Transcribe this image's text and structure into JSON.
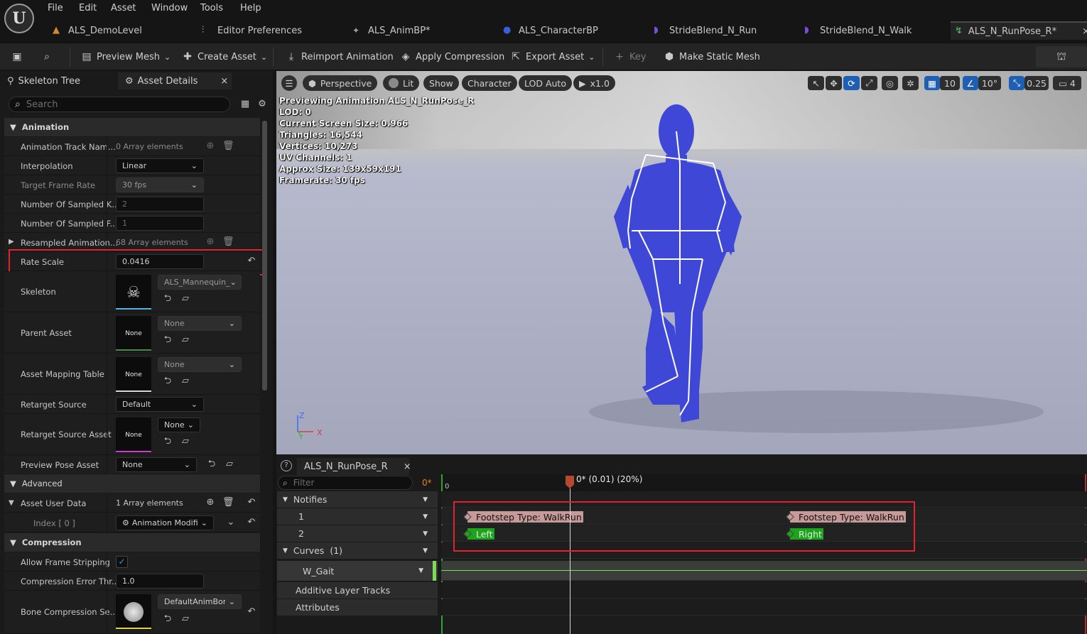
{
  "menu": [
    "File",
    "Edit",
    "Asset",
    "Window",
    "Tools",
    "Help"
  ],
  "doc_tabs": [
    "ALS_DemoLevel",
    "Editor Preferences",
    "ALS_AnimBP*",
    "ALS_CharacterBP",
    "StrideBlend_N_Run",
    "StrideBlend_N_Walk",
    "ALS_N_RunPose_R*"
  ],
  "toolbar": {
    "preview_mesh": "Preview Mesh",
    "create_asset": "Create Asset",
    "reimport": "Reimport Animation",
    "apply_compression": "Apply Compression",
    "export_asset": "Export Asset",
    "key": "Key",
    "make_static_mesh": "Make Static Mesh"
  },
  "left_tabs": {
    "skeleton_tree": "Skeleton Tree",
    "asset_details": "Asset Details"
  },
  "search": {
    "placeholder": "Search"
  },
  "details": {
    "animation_category": "Animation",
    "track_names_label": "Animation Track Nam...",
    "track_names_value": "0 Array elements",
    "interpolation_label": "Interpolation",
    "interpolation_value": "Linear",
    "target_frame_rate_label": "Target Frame Rate",
    "target_frame_rate_value": "30 fps",
    "sampled_keys_label": "Number Of Sampled K...",
    "sampled_keys_value": "2",
    "sampled_frames_label": "Number Of Sampled F...",
    "sampled_frames_value": "1",
    "resampled_label": "Resampled Animation...",
    "resampled_value": "68 Array elements",
    "rate_scale_label": "Rate Scale",
    "rate_scale_value": "0.0416",
    "skeleton_label": "Skeleton",
    "skeleton_value": "ALS_Mannequin_",
    "parent_asset_label": "Parent Asset",
    "parent_asset_value": "None",
    "parent_asset_thumb": "None",
    "mapping_table_label": "Asset Mapping Table",
    "mapping_table_value": "None",
    "mapping_table_thumb": "None",
    "retarget_source_label": "Retarget Source",
    "retarget_source_value": "Default",
    "retarget_source_asset_label": "Retarget Source Asset",
    "retarget_source_asset_value": "None",
    "retarget_source_asset_thumb": "None",
    "preview_pose_label": "Preview Pose Asset",
    "preview_pose_value": "None",
    "advanced_category": "Advanced",
    "user_data_label": "Asset User Data",
    "user_data_value": "1 Array elements",
    "index_label": "Index [ 0 ]",
    "index_value": "Animation Modifi",
    "compression_category": "Compression",
    "frame_stripping_label": "Allow Frame Stripping",
    "error_threshold_label": "Compression Error Thr...",
    "error_threshold_value": "1.0",
    "bone_compression_label": "Bone Compression Se...",
    "bone_compression_value": "DefaultAnimBone"
  },
  "viewport": {
    "perspective": "Perspective",
    "lit": "Lit",
    "show": "Show",
    "character": "Character",
    "lod": "LOD Auto",
    "speed": "x1.0",
    "grid": "10",
    "angle": "10°",
    "scale": "0.25",
    "camera": "4",
    "stats": [
      "Previewing Animation ALS_N_RunPose_R",
      "LOD: 0",
      "Current Screen Size: 0.966",
      "Triangles: 16,544",
      "Vertices: 10,273",
      "UV Channels: 1",
      "Approx Size: 139x59x191",
      "Framerate: 30 fps"
    ],
    "axis_z": "Z",
    "axis_x": "X",
    "axis_y": "Y"
  },
  "timeline": {
    "tab": "ALS_N_RunPose_R",
    "filter_placeholder": "Filter",
    "frame_counter": "0*",
    "ruler_start": "0",
    "playhead_label": "0* (0.01) (20%)",
    "notifies": "Notifies",
    "track1": "1",
    "track2": "2",
    "curves": "Curves",
    "curves_count": "(1)",
    "curve_name": "W_Gait",
    "additive": "Additive Layer Tracks",
    "attributes": "Attributes",
    "notify_footstep_1": "Footstep Type: WalkRun",
    "notify_footstep_2": "Footstep Type: WalkRun",
    "notify_left": "Left",
    "notify_right": "Right"
  },
  "colors": {
    "highlight_red": "#e0242f",
    "character_blue": "#3f47d6",
    "notify_pink": "#c79a9a",
    "notify_green": "#1fa31f"
  }
}
